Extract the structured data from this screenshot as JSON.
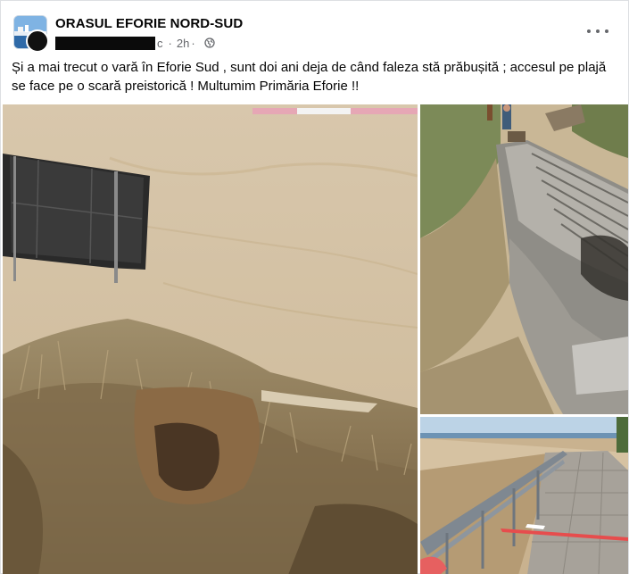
{
  "post": {
    "page_name": "ORASUL EFORIE NORD-SUD",
    "author_suffix": "c",
    "separator": "·",
    "time": "2h",
    "privacy_icon": "globe-icon",
    "more_icon": "more-options-icon",
    "text": "Și a mai trecut o vară în Eforie Sud , sunt doi ani deja de când faleza stă prăbușită ; accesul pe plajă se face pe o scară preistorică ! Multumim Primăria Eforie !!"
  },
  "photos": [
    {
      "name": "photo-collapsed-cliff",
      "subject": "collapsed cliff with dry grass and fallen sign above beach"
    },
    {
      "name": "photo-stairs",
      "subject": "broken stone stairs leading to beach"
    },
    {
      "name": "photo-promenade",
      "subject": "promenade with railing and warning tape"
    }
  ],
  "colors": {
    "text_primary": "#050505",
    "text_secondary": "#65676b",
    "border": "#dddfe2"
  }
}
